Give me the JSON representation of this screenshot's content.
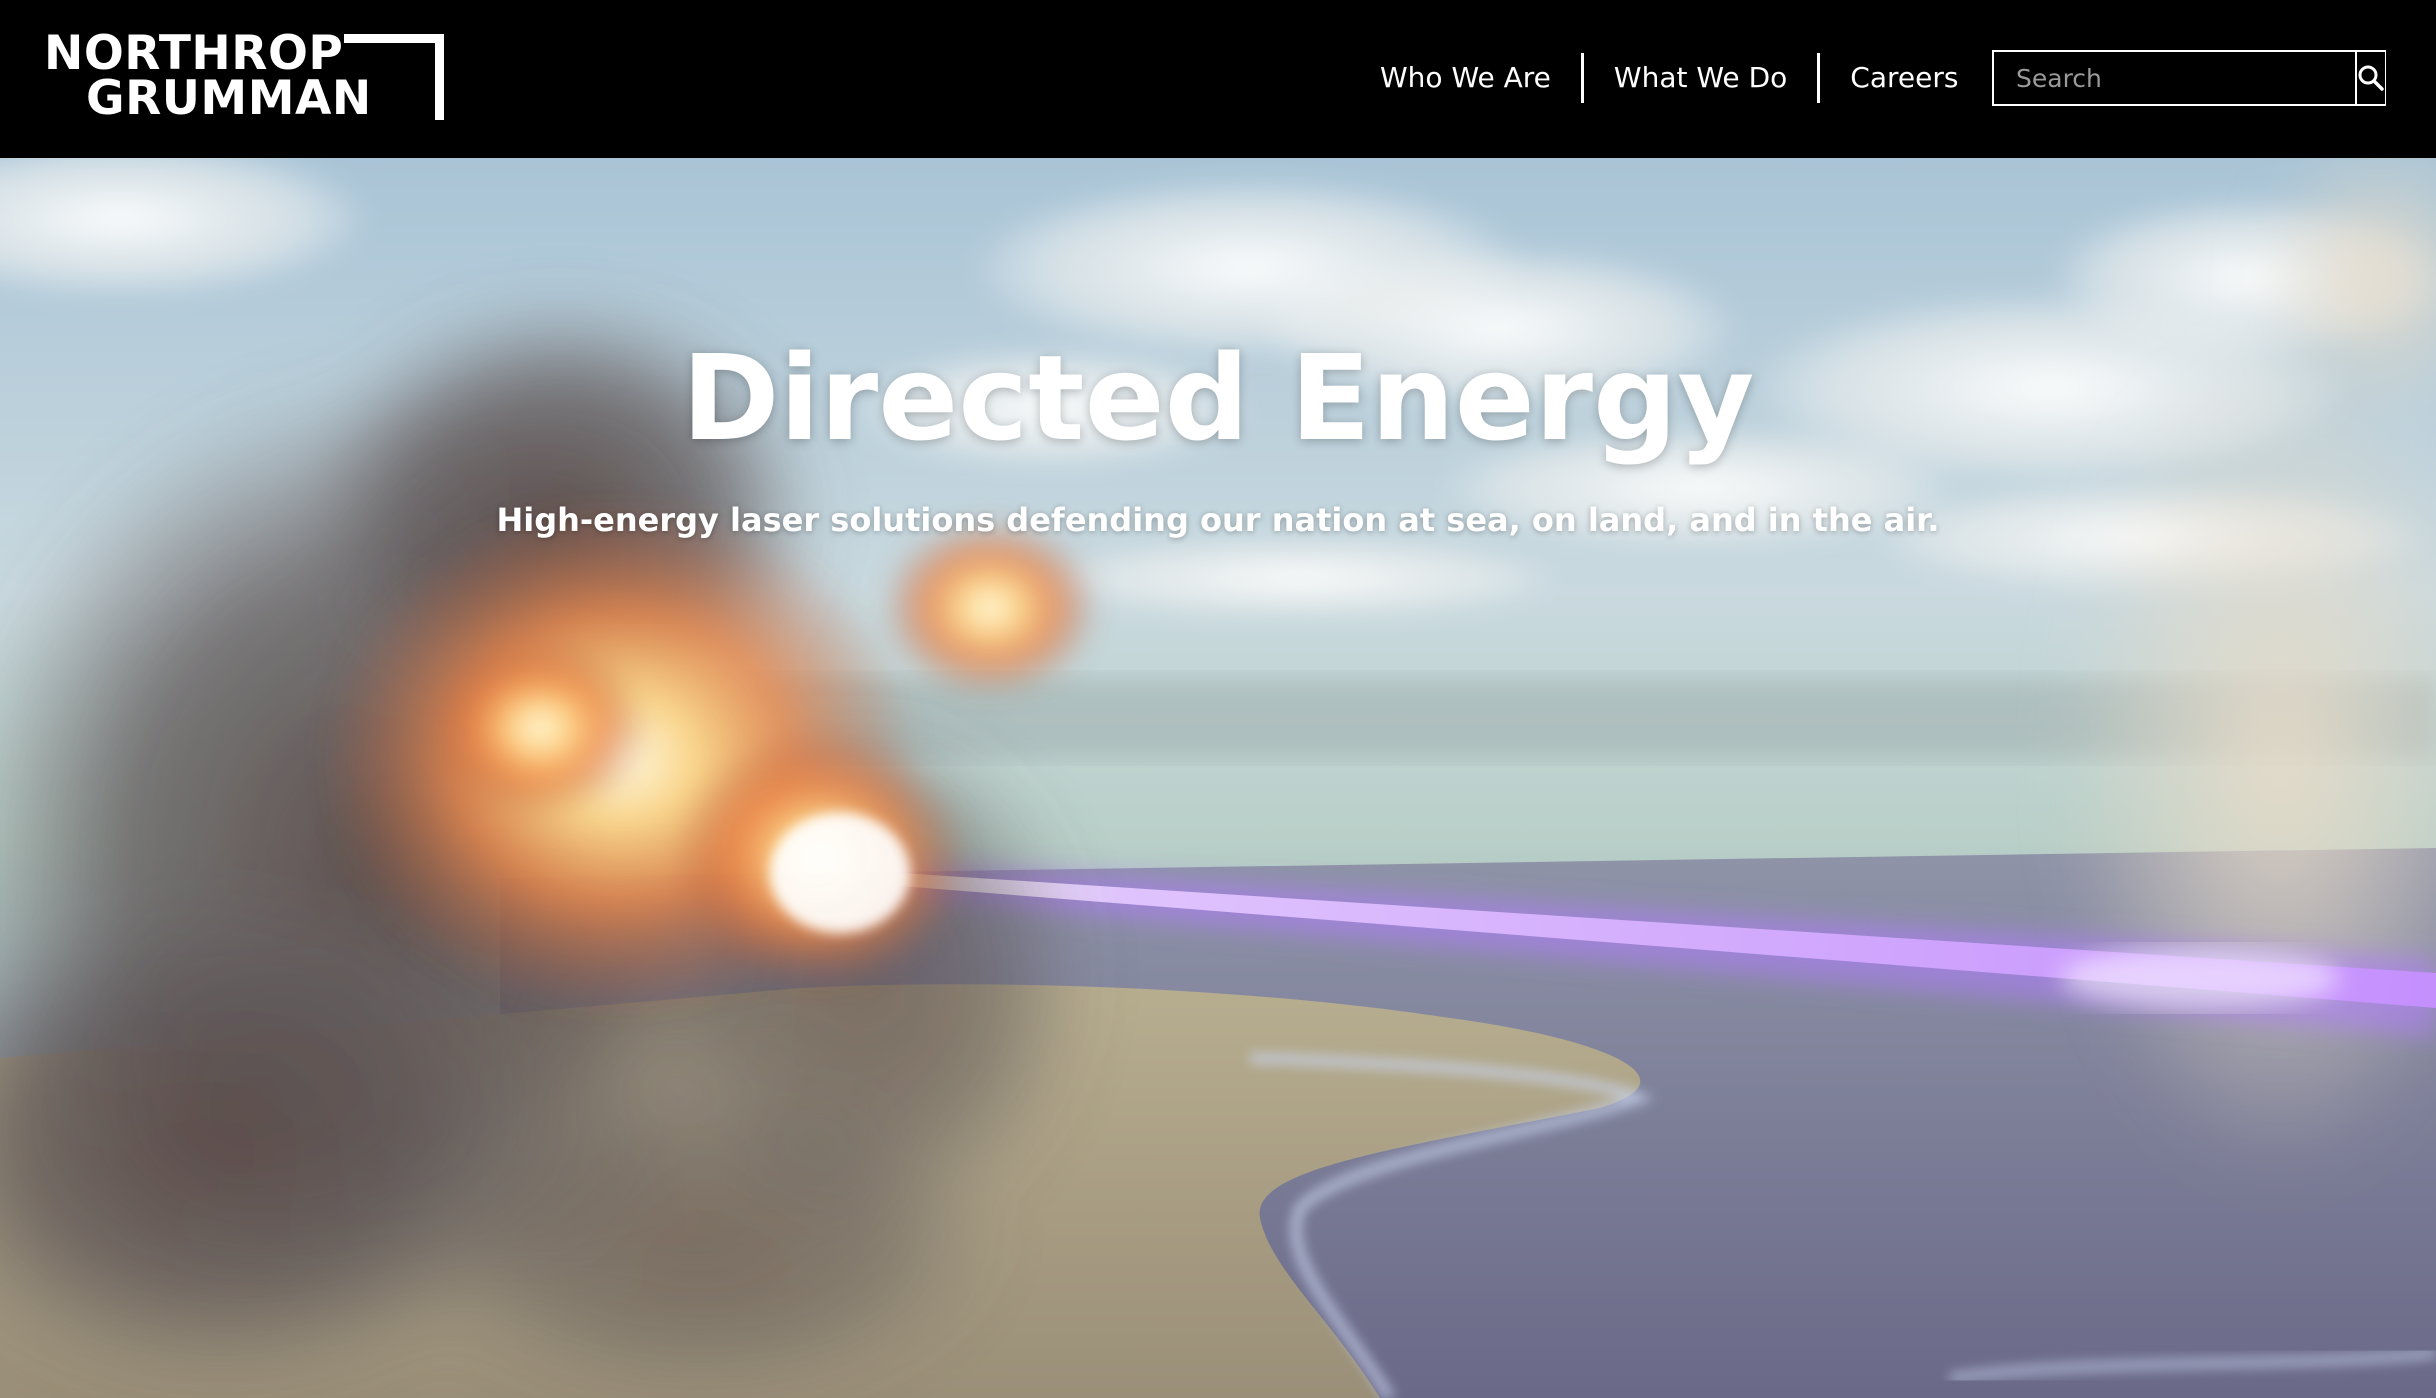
{
  "brand": {
    "logo_line1": "NORTHROP",
    "logo_line2": "GRUMMAN"
  },
  "nav": {
    "items": [
      {
        "label": "Who We Are"
      },
      {
        "label": "What We Do"
      },
      {
        "label": "Careers"
      }
    ]
  },
  "search": {
    "placeholder": "Search",
    "value": "",
    "icon": "search-icon"
  },
  "hero": {
    "title": "Directed Energy",
    "subtitle": "High-energy laser solutions defending our nation at sea, on land, and in the air."
  },
  "colors": {
    "header_bg": "#000000",
    "text": "#ffffff",
    "laser": "#b57bff"
  }
}
